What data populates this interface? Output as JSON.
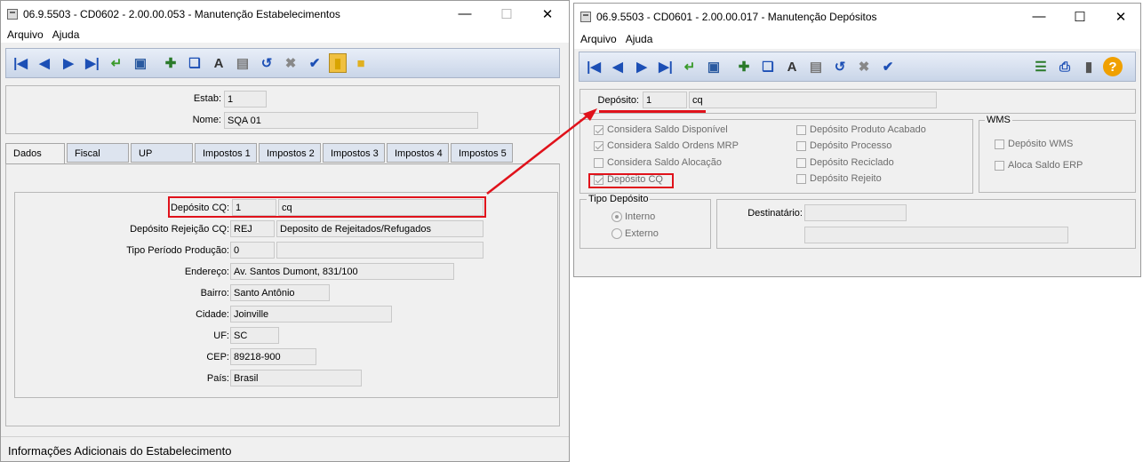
{
  "left_window": {
    "title": "06.9.5503 - CD0602 - 2.00.00.053 - Manutenção Estabelecimentos",
    "menu": [
      "Arquivo",
      "Ajuda"
    ],
    "estab_label": "Estab:",
    "estab_value": "1",
    "nome_label": "Nome:",
    "nome_value": "SQA 01",
    "tabs": [
      "Dados",
      "Fiscal",
      "UP",
      "Impostos 1",
      "Impostos 2",
      "Impostos 3",
      "Impostos 4",
      "Impostos 5"
    ],
    "fields": {
      "deposito_cq_label": "Depósito CQ:",
      "deposito_cq_code": "1",
      "deposito_cq_desc": "cq",
      "deposito_rej_label": "Depósito Rejeição CQ:",
      "deposito_rej_code": "REJ",
      "deposito_rej_desc": "Deposito de Rejeitados/Refugados",
      "tipo_periodo_label": "Tipo Período Produção:",
      "tipo_periodo_value": "0",
      "endereco_label": "Endereço:",
      "endereco_value": "Av. Santos Dumont, 831/100",
      "bairro_label": "Bairro:",
      "bairro_value": "Santo Antônio",
      "cidade_label": "Cidade:",
      "cidade_value": "Joinville",
      "uf_label": "UF:",
      "uf_value": "SC",
      "cep_label": "CEP:",
      "cep_value": "89218-900",
      "pais_label": "País:",
      "pais_value": "Brasil"
    },
    "status": "Informações Adicionais do Estabelecimento"
  },
  "right_window": {
    "title": "06.9.5503 - CD0601 - 2.00.00.017 - Manutenção Depósitos",
    "menu": [
      "Arquivo",
      "Ajuda"
    ],
    "deposito_label": "Depósito:",
    "deposito_code": "1",
    "deposito_desc": "cq",
    "checks_left": [
      {
        "label": "Considera Saldo Disponível",
        "checked": true
      },
      {
        "label": "Considera Saldo Ordens MRP",
        "checked": true
      },
      {
        "label": "Considera Saldo Alocação",
        "checked": false
      },
      {
        "label": "Depósito CQ",
        "checked": true
      }
    ],
    "checks_right": [
      {
        "label": "Depósito Produto Acabado",
        "checked": false
      },
      {
        "label": "Depósito Processo",
        "checked": false
      },
      {
        "label": "Depósito Reciclado",
        "checked": false
      },
      {
        "label": "Depósito Rejeito",
        "checked": false
      }
    ],
    "wms_title": "WMS",
    "wms_checks": [
      {
        "label": "Depósito WMS",
        "checked": false
      },
      {
        "label": "Aloca Saldo ERP",
        "checked": false
      }
    ],
    "tipo_deposito_title": "Tipo Depósito",
    "tipo_options": [
      {
        "label": "Interno",
        "selected": true
      },
      {
        "label": "Externo",
        "selected": false
      }
    ],
    "destinatario_label": "Destinatário:"
  },
  "colors": {
    "highlight": "#e0121b",
    "toolbar_blue": "#1c4fb5"
  }
}
